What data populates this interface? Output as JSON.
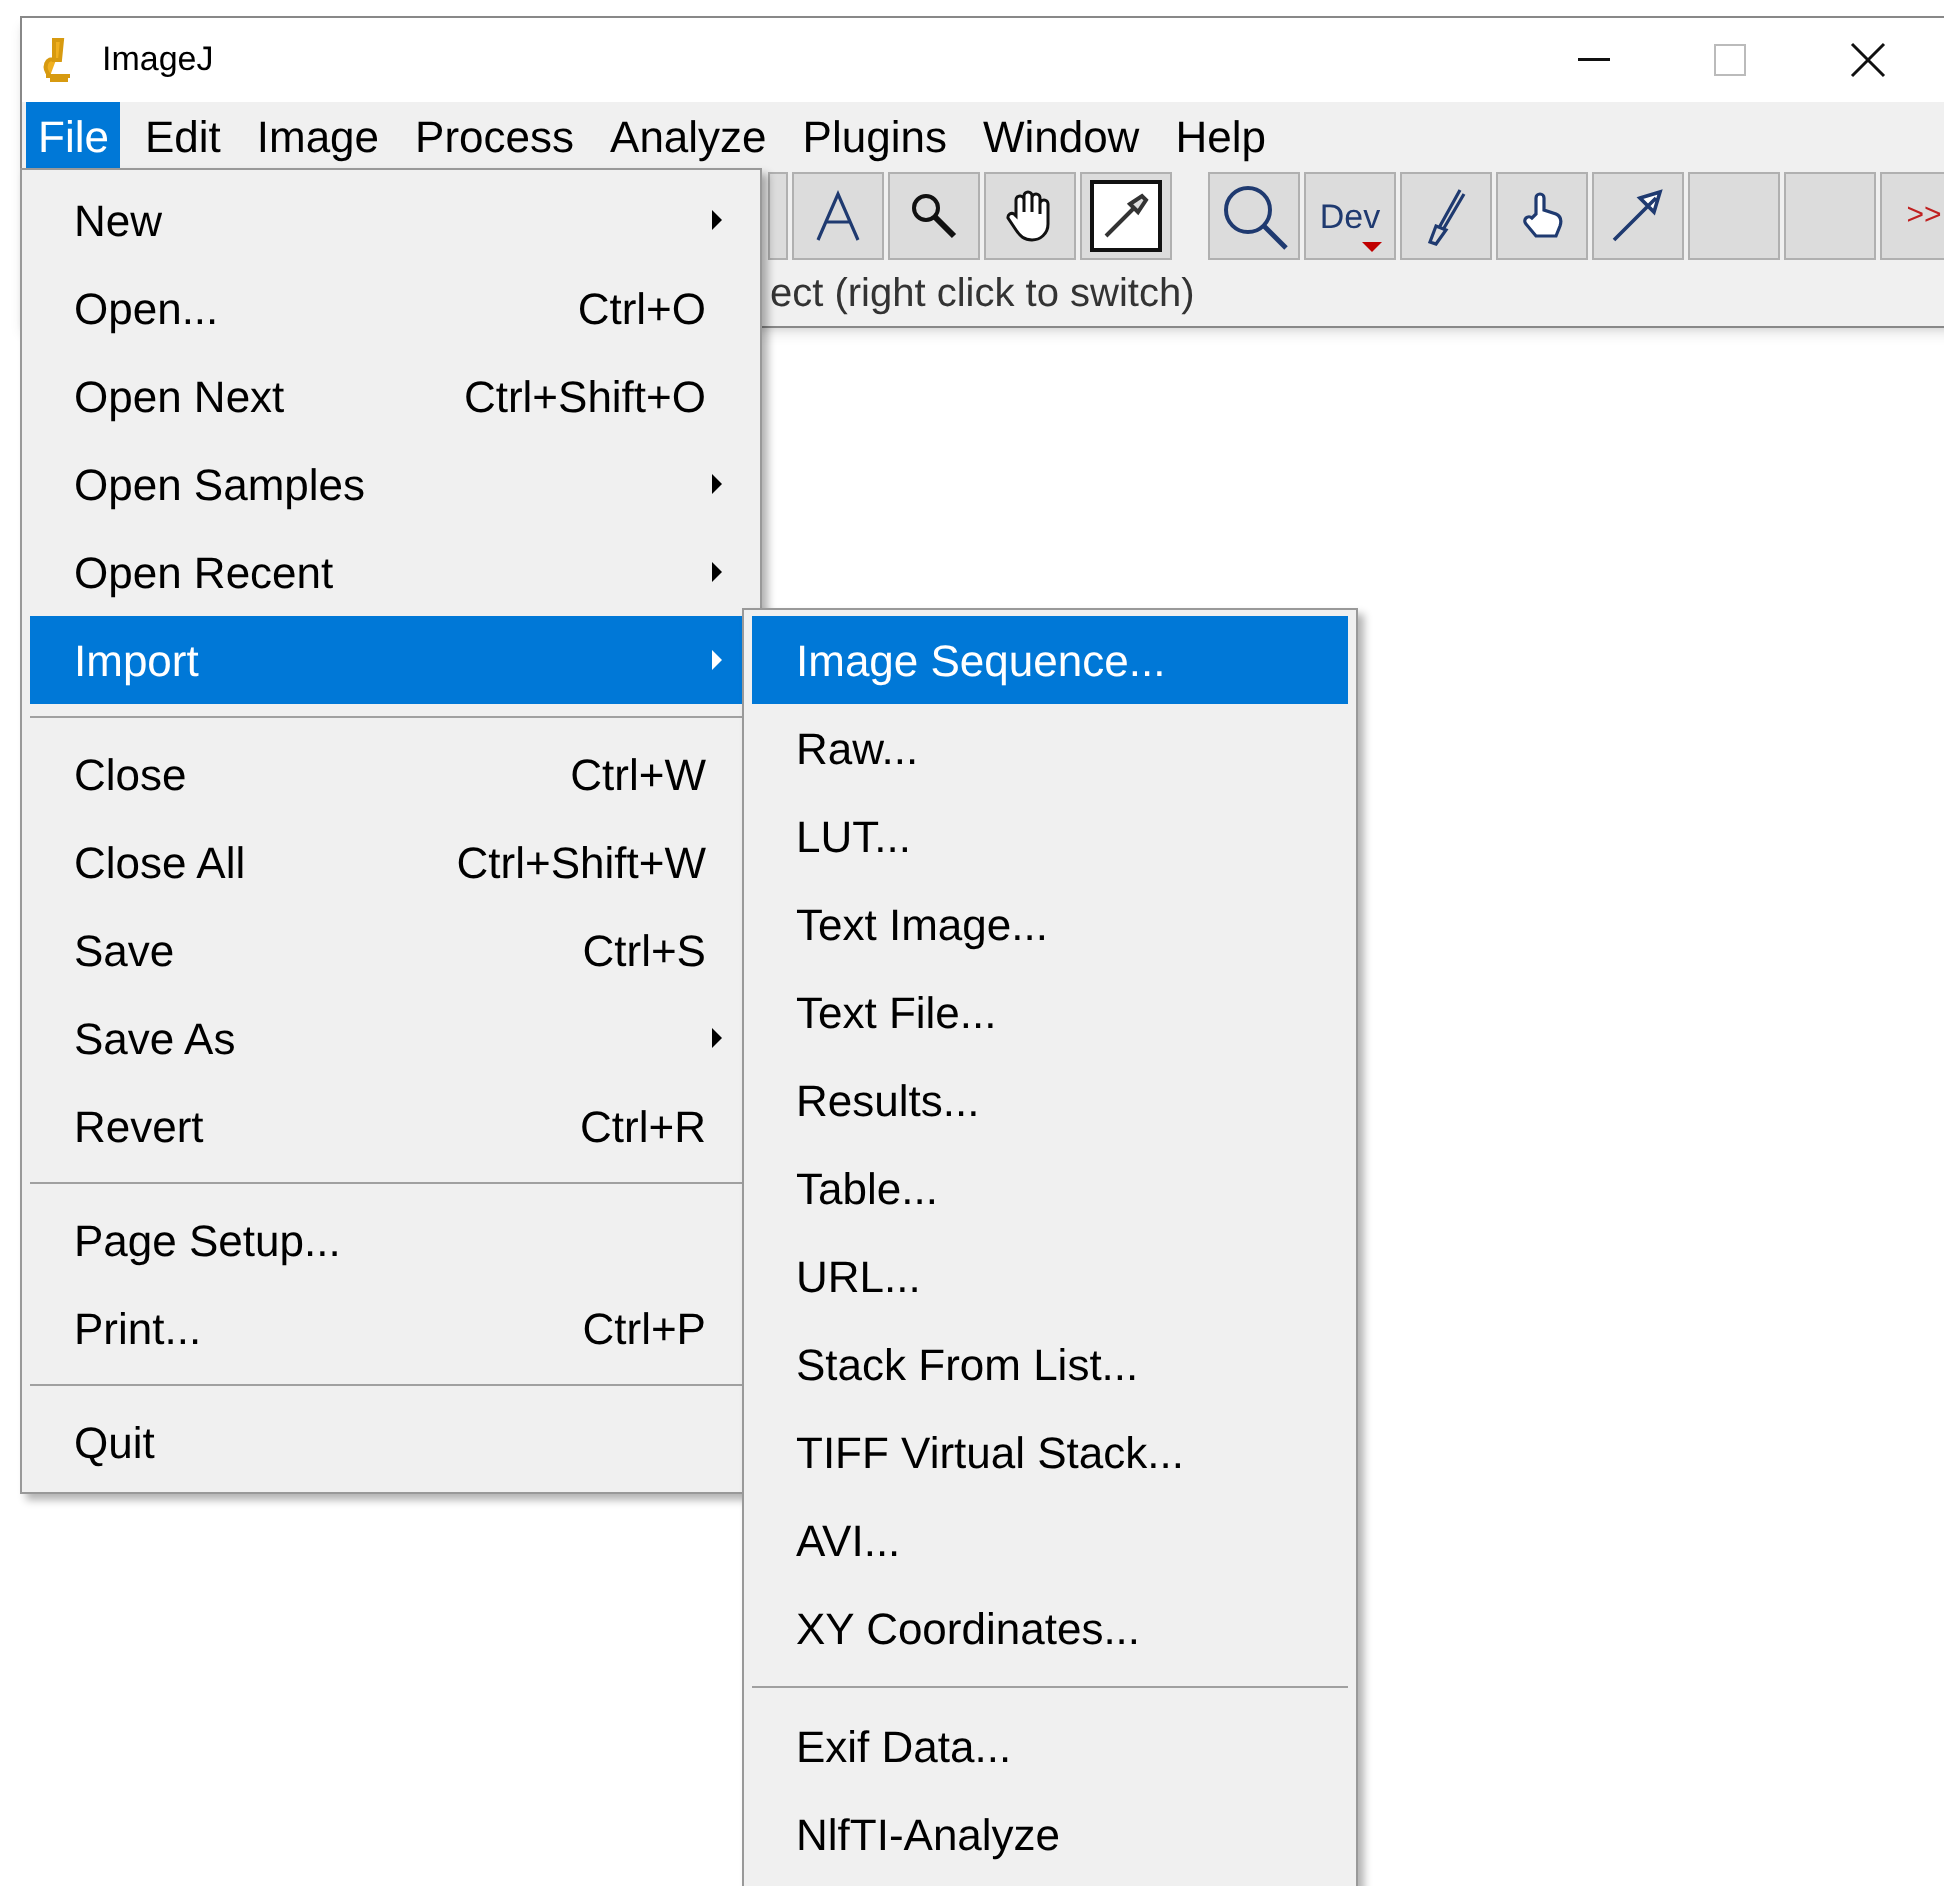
{
  "window": {
    "title": "ImageJ"
  },
  "menu_bar": [
    {
      "label": "File",
      "selected": true
    },
    {
      "label": "Edit",
      "selected": false
    },
    {
      "label": "Image",
      "selected": false
    },
    {
      "label": "Process",
      "selected": false
    },
    {
      "label": "Analyze",
      "selected": false
    },
    {
      "label": "Plugins",
      "selected": false
    },
    {
      "label": "Window",
      "selected": false
    },
    {
      "label": "Help",
      "selected": false
    }
  ],
  "toolbar": [
    {
      "kind": "partial"
    },
    {
      "kind": "text"
    },
    {
      "kind": "magnifier"
    },
    {
      "kind": "hand"
    },
    {
      "kind": "dropper"
    },
    {
      "kind": "gap"
    },
    {
      "kind": "zoom"
    },
    {
      "kind": "dev",
      "label": "Dev"
    },
    {
      "kind": "brush"
    },
    {
      "kind": "point-hand"
    },
    {
      "kind": "arrow"
    },
    {
      "kind": "blank"
    },
    {
      "kind": "blank"
    },
    {
      "kind": "more",
      "label": ">>"
    }
  ],
  "status_bar": "ect (right click to switch)",
  "file_menu": [
    [
      {
        "label": "New",
        "submenu": true,
        "selected": false
      },
      {
        "label": "Open...",
        "shortcut": "Ctrl+O",
        "submenu": false,
        "selected": false
      },
      {
        "label": "Open Next",
        "shortcut": "Ctrl+Shift+O",
        "submenu": false,
        "selected": false
      },
      {
        "label": "Open Samples",
        "submenu": true,
        "selected": false
      },
      {
        "label": "Open Recent",
        "submenu": true,
        "selected": false
      },
      {
        "label": "Import",
        "submenu": true,
        "selected": true
      }
    ],
    [
      {
        "label": "Close",
        "shortcut": "Ctrl+W",
        "submenu": false,
        "selected": false
      },
      {
        "label": "Close All",
        "shortcut": "Ctrl+Shift+W",
        "submenu": false,
        "selected": false
      },
      {
        "label": "Save",
        "shortcut": "Ctrl+S",
        "submenu": false,
        "selected": false
      },
      {
        "label": "Save As",
        "submenu": true,
        "selected": false
      },
      {
        "label": "Revert",
        "shortcut": "Ctrl+R",
        "submenu": false,
        "selected": false
      }
    ],
    [
      {
        "label": "Page Setup...",
        "submenu": false,
        "selected": false
      },
      {
        "label": "Print...",
        "shortcut": "Ctrl+P",
        "submenu": false,
        "selected": false
      }
    ],
    [
      {
        "label": "Quit",
        "submenu": false,
        "selected": false
      }
    ]
  ],
  "import_menu": [
    [
      {
        "label": "Image Sequence...",
        "selected": true
      },
      {
        "label": "Raw...",
        "selected": false
      },
      {
        "label": "LUT...",
        "selected": false
      },
      {
        "label": "Text Image...",
        "selected": false
      },
      {
        "label": "Text File...",
        "selected": false
      },
      {
        "label": "Results...",
        "selected": false
      },
      {
        "label": "Table...",
        "selected": false
      },
      {
        "label": "URL...",
        "selected": false
      },
      {
        "label": "Stack From List...",
        "selected": false
      },
      {
        "label": "TIFF Virtual Stack...",
        "selected": false
      },
      {
        "label": "AVI...",
        "selected": false
      },
      {
        "label": "XY Coordinates...",
        "selected": false
      }
    ],
    [
      {
        "label": "Exif Data...",
        "selected": false
      },
      {
        "label": "NlfTI-Analyze",
        "selected": false
      }
    ]
  ]
}
